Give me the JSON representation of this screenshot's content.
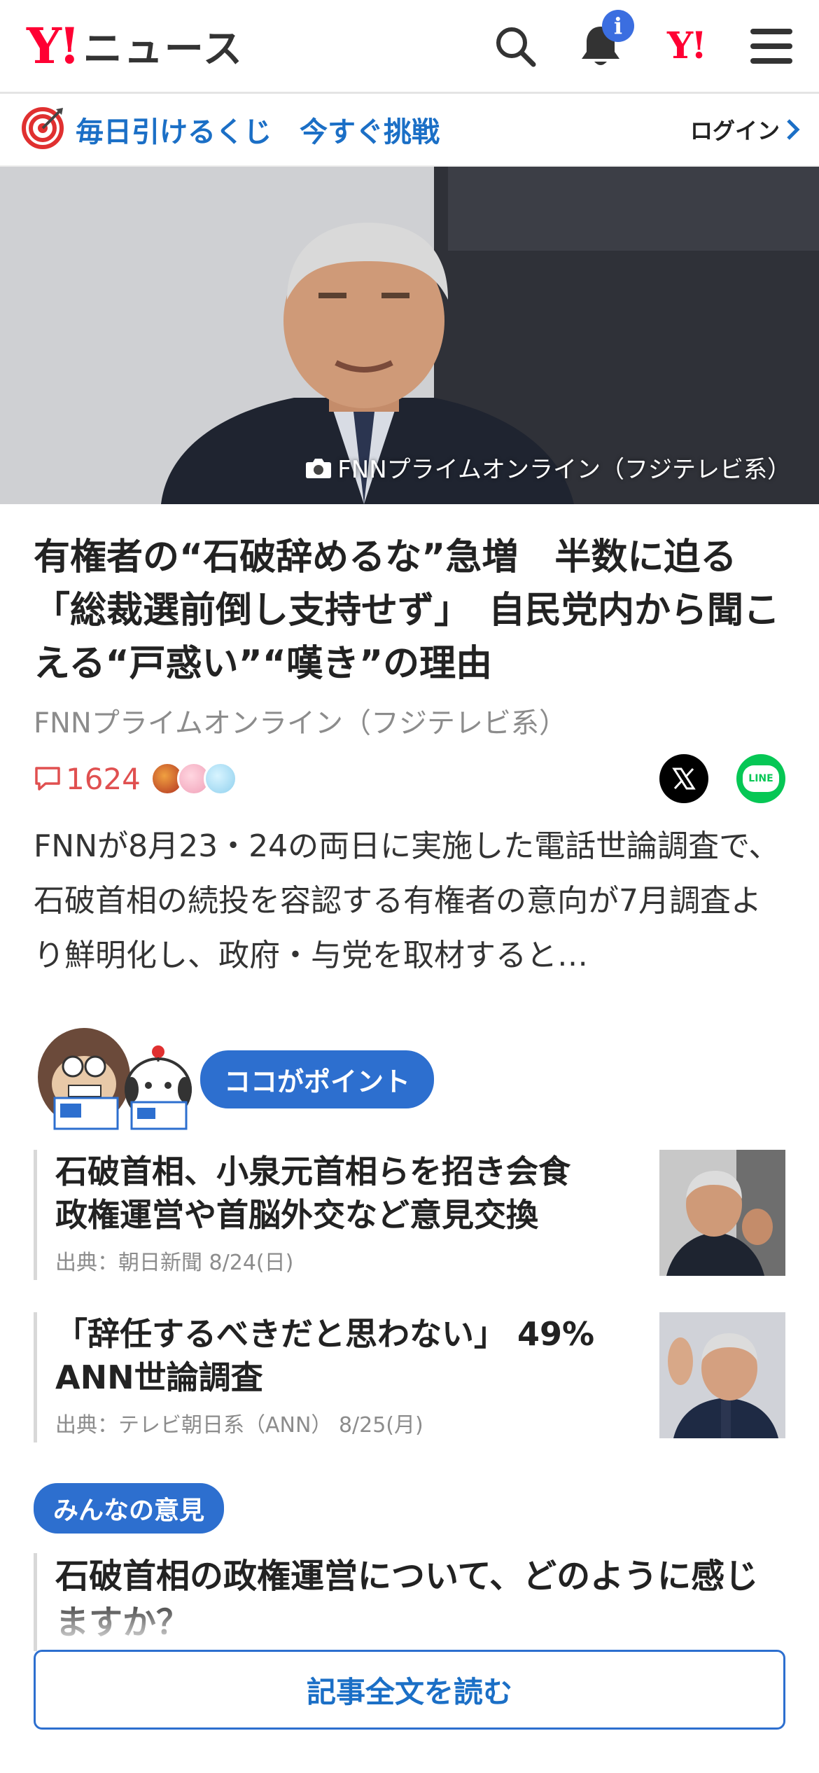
{
  "header": {
    "logo_mark": "Y!",
    "logo_text": "ニュース",
    "notification_badge": "i",
    "yjapan_mark": "Y!"
  },
  "lottery": {
    "text": "毎日引けるくじ　今すぐ挑戦",
    "login_label": "ログイン"
  },
  "hero": {
    "credit": "FNNプライムオンライン（フジテレビ系）"
  },
  "article": {
    "headline": "有権者の“石破辞めるな”急増　半数に迫る「総裁選前倒し支持せず」　自民党内から聞こえる“戸惑い”“嘆き”の理由",
    "source": "FNNプライムオンライン（フジテレビ系）",
    "comment_count": "1624",
    "share_x_label": "X",
    "share_line_label": "LINE",
    "summary": "FNNが8月23・24の両日に実施した電話世論調査で、石破首相の続投を容認する有権者の意向が7月調査より鮮明化し、政府・与党を取材すると…"
  },
  "points": {
    "label": "ココがポイント",
    "items": [
      {
        "title": "石破首相、小泉元首相らを招き会食　政権運営や首脳外交など意見交換",
        "source": "出典：朝日新聞 8/24(日)"
      },
      {
        "title": "「辞任するべきだと思わない」 49% ANN世論調査",
        "source": "出典：テレビ朝日系（ANN） 8/25(月)"
      }
    ]
  },
  "opinion": {
    "label": "みんなの意見",
    "question": "石破首相の政権運営について、どのように感じますか？"
  },
  "read_more": "記事全文を読む",
  "colors": {
    "brand_red": "#ff0033",
    "link_blue": "#1b6fc6",
    "pill_blue": "#2d6fcf",
    "comment_red": "#e05050",
    "line_green": "#06c755"
  },
  "icons": [
    "search-icon",
    "bell-icon",
    "hamburger-menu-icon",
    "target-icon",
    "chevron-right-icon",
    "camera-icon",
    "comment-icon",
    "x-logo-icon",
    "line-logo-icon"
  ]
}
